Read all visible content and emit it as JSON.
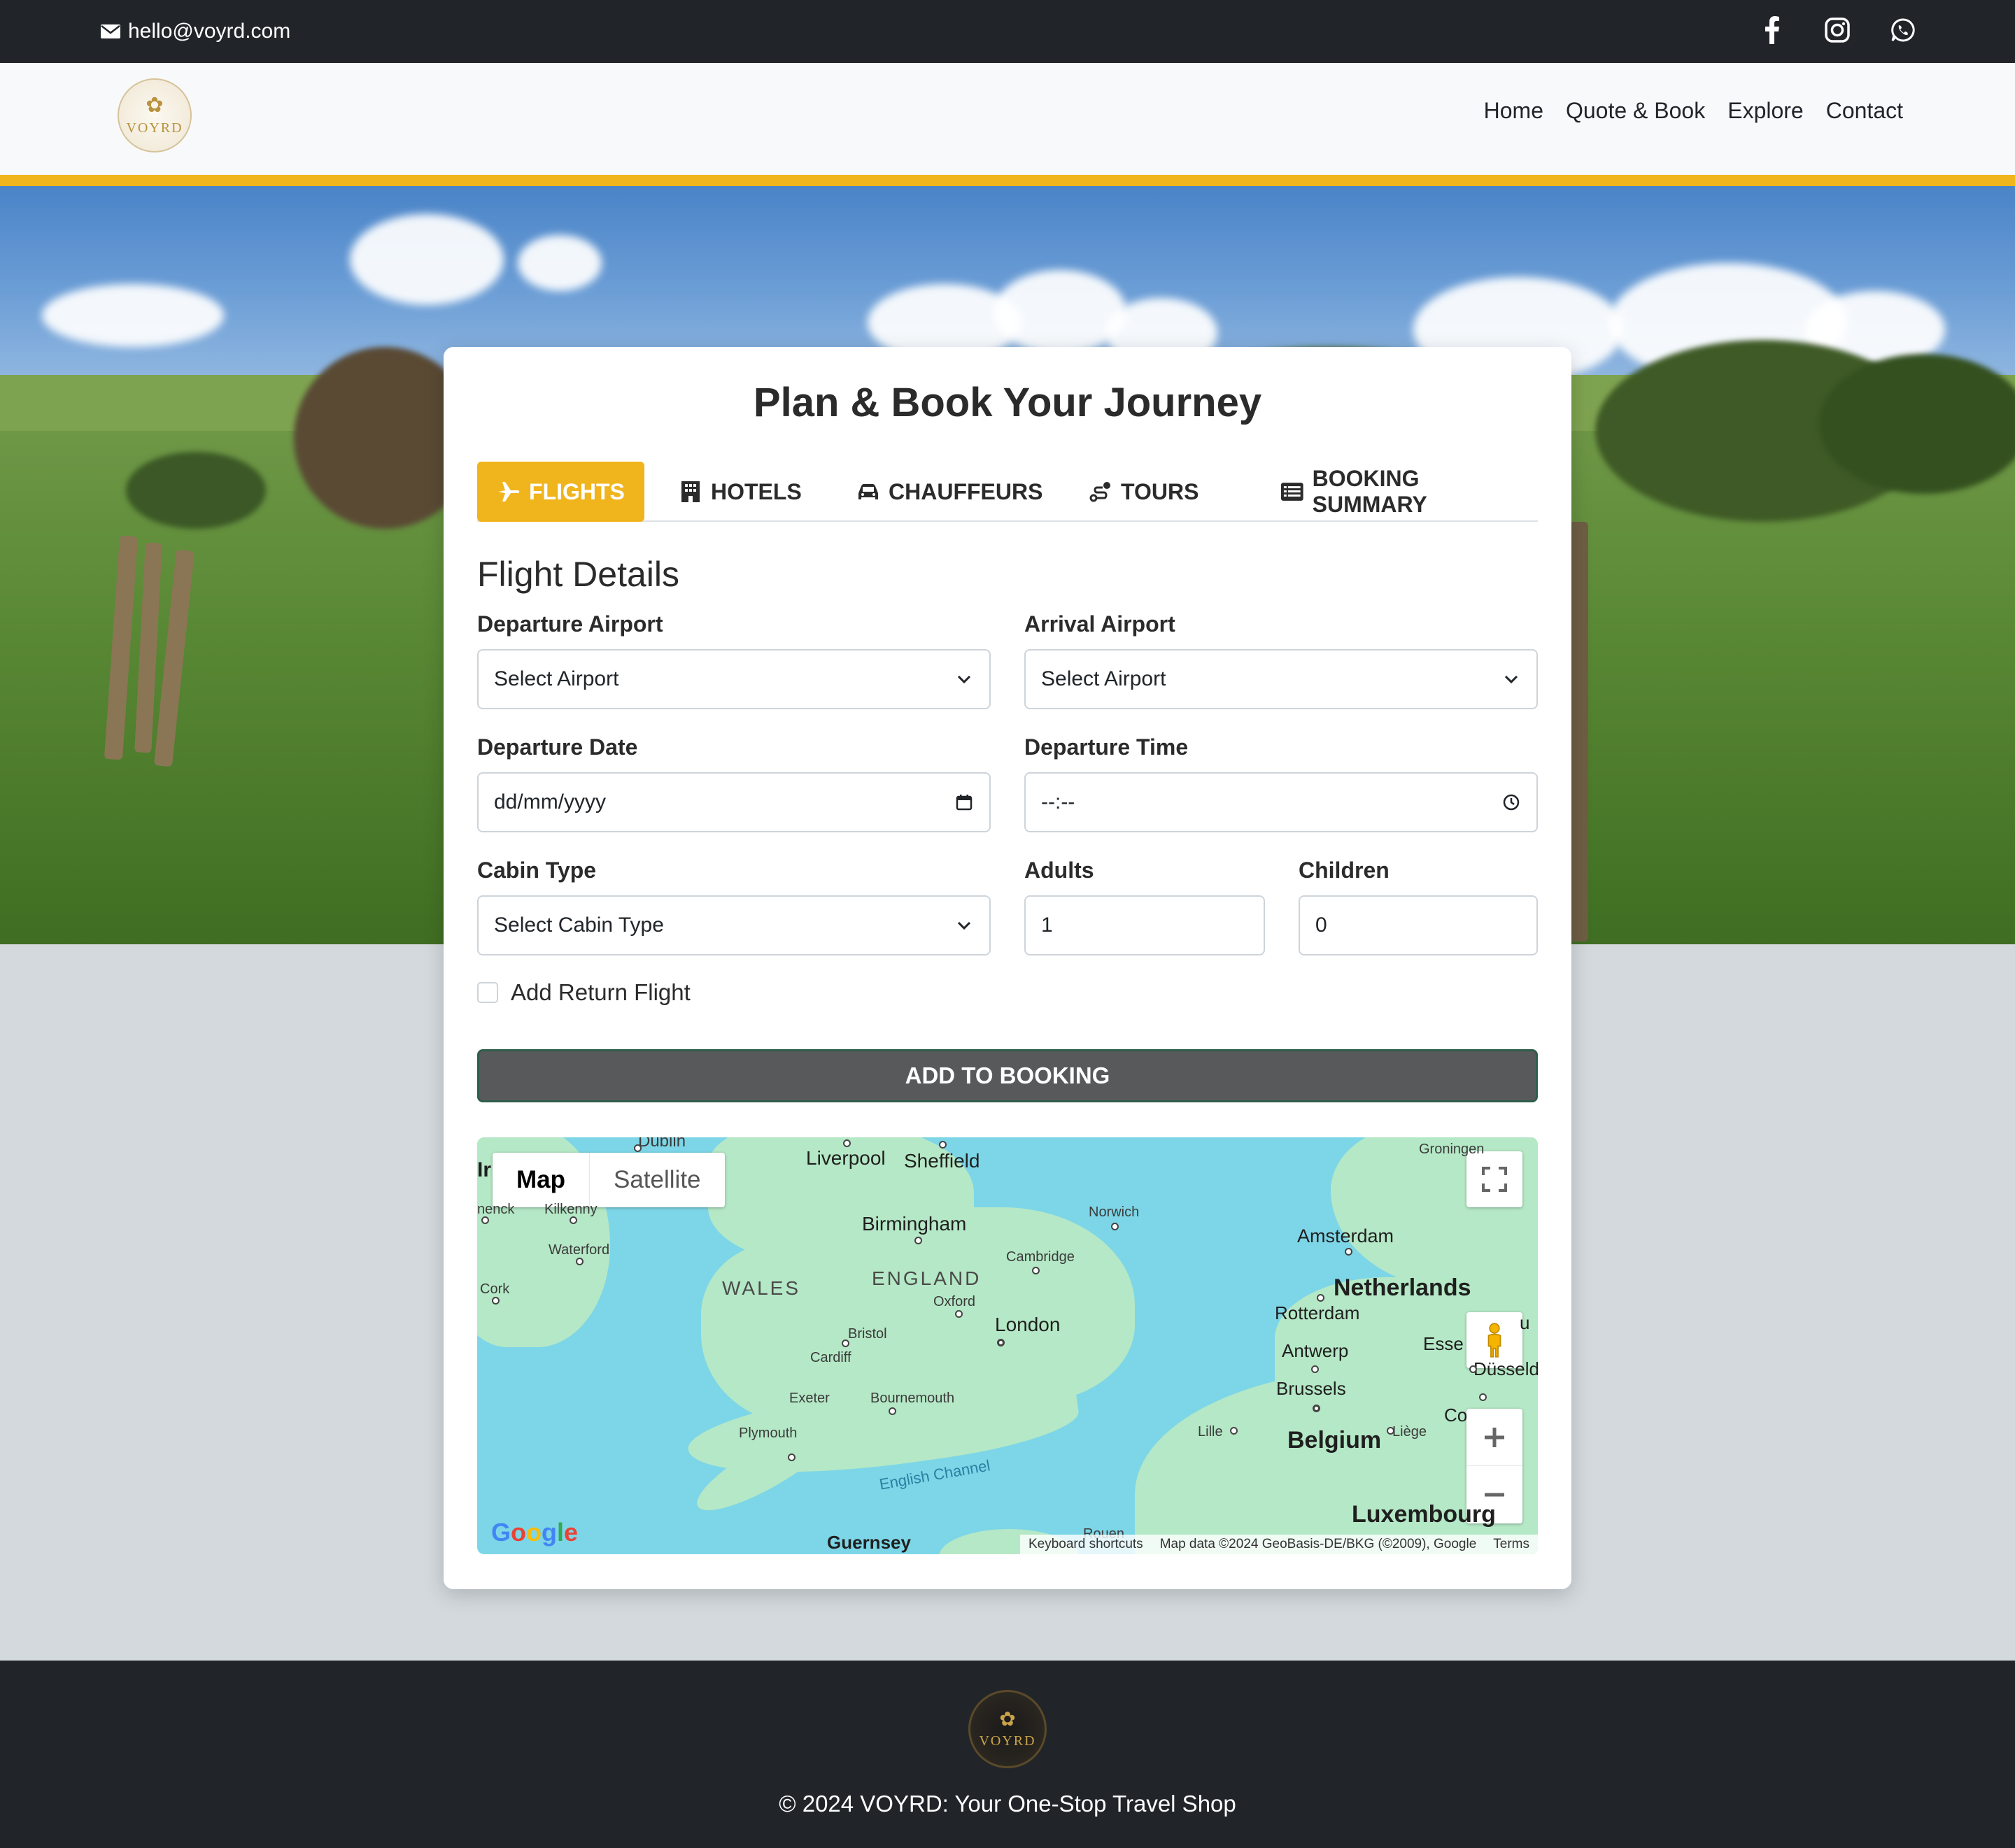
{
  "topbar": {
    "email": "hello@voyrd.com",
    "social": [
      "facebook-icon",
      "instagram-icon",
      "whatsapp-icon"
    ]
  },
  "nav": {
    "logo_text": "VOYRD",
    "links": [
      "Home",
      "Quote & Book",
      "Explore",
      "Contact"
    ]
  },
  "card": {
    "title": "Plan & Book Your Journey",
    "tabs": [
      {
        "label": "FLIGHTS",
        "icon": "plane-icon",
        "active": true
      },
      {
        "label": "HOTELS",
        "icon": "building-icon",
        "active": false
      },
      {
        "label": "CHAUFFEURS",
        "icon": "car-icon",
        "active": false
      },
      {
        "label": "TOURS",
        "icon": "route-icon",
        "active": false
      },
      {
        "label": "BOOKING SUMMARY",
        "icon": "list-icon",
        "active": false
      }
    ],
    "section_title": "Flight Details",
    "fields": {
      "departure_airport": {
        "label": "Departure Airport",
        "value": "Select Airport"
      },
      "arrival_airport": {
        "label": "Arrival Airport",
        "value": "Select Airport"
      },
      "departure_date": {
        "label": "Departure Date",
        "value": "dd/mm/yyyy"
      },
      "departure_time": {
        "label": "Departure Time",
        "value": "--:--"
      },
      "cabin_type": {
        "label": "Cabin Type",
        "value": "Select Cabin Type"
      },
      "adults": {
        "label": "Adults",
        "value": "1"
      },
      "children": {
        "label": "Children",
        "value": "0"
      }
    },
    "return_flight_label": "Add Return Flight",
    "add_button": "ADD TO BOOKING"
  },
  "map": {
    "toggle": [
      "Map",
      "Satellite"
    ],
    "labels": {
      "liverpool": "Liverpool",
      "sheffield": "Sheffield",
      "birmingham": "Birmingham",
      "norwich": "Norwich",
      "cambridge": "Cambridge",
      "wales": "WALES",
      "england": "ENGLAND",
      "oxford": "Oxford",
      "london": "London",
      "bristol": "Bristol",
      "cardiff": "Cardiff",
      "exeter": "Exeter",
      "bournemouth": "Bournemouth",
      "plymouth": "Plymouth",
      "english_channel": "English Channel",
      "guernsey": "Guernsey",
      "kilkenny": "Kilkenny",
      "waterford": "Waterford",
      "cork": "Cork",
      "amsterdam": "Amsterdam",
      "netherlands": "Netherlands",
      "rotterdam": "Rotterdam",
      "antwerp": "Antwerp",
      "brussels": "Brussels",
      "belgium": "Belgium",
      "lille": "Lille",
      "liege": "Liège",
      "luxembourg": "Luxembourg",
      "groningen": "Groningen",
      "essen": "Esse",
      "dusseldorf": "Düsseld",
      "dublin": "Dublin",
      "rouen": "Rouen",
      "co": "Co",
      "ir": "Ir",
      "henck": "nenck",
      "ui": "u"
    },
    "google": "Google",
    "attribution": [
      "Keyboard shortcuts",
      "Map data ©2024 GeoBasis-DE/BKG (©2009), Google",
      "Terms"
    ]
  },
  "footer": {
    "logo_text": "VOYRD",
    "copyright": "© 2024 VOYRD: Your One-Stop Travel Shop"
  },
  "colors": {
    "accent": "#f0b41c",
    "dark": "#212529",
    "button": "#58595b"
  }
}
